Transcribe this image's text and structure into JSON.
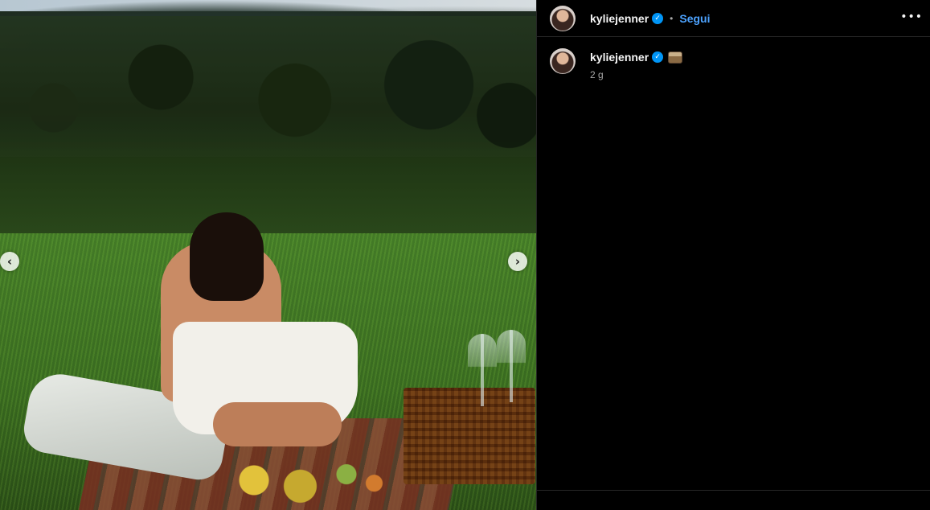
{
  "post": {
    "username": "kyliejenner",
    "follow_label": "Segui",
    "separator": "•",
    "more_label": "•••",
    "verified_mark": "✓",
    "time_ago": "2 g",
    "caption_emoji": "picnic-basket-emoji",
    "nav_prev": "‹",
    "nav_next": "›"
  },
  "colors": {
    "accent": "#4da3ff",
    "verified": "#0095f6",
    "background": "#000000",
    "border": "#262626"
  },
  "icons": [
    "verified-badge-icon",
    "more-options-icon",
    "chevron-left-icon",
    "chevron-right-icon"
  ]
}
